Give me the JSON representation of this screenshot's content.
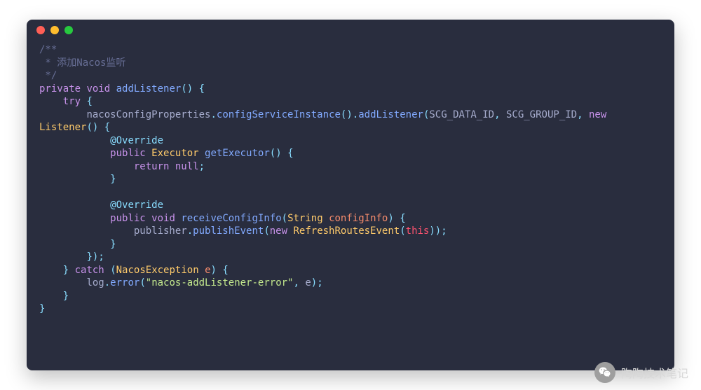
{
  "window": {
    "dots": [
      "red",
      "yellow",
      "green"
    ]
  },
  "code": {
    "comment_open": "/**",
    "comment_body": " * 添加Nacos监听",
    "comment_close": " */",
    "kw_private": "private",
    "kw_void": "void",
    "kw_try": "try",
    "kw_catch": "catch",
    "kw_new": "new",
    "kw_public": "public",
    "kw_return": "return",
    "kw_null": "null",
    "anno_override": "@Override",
    "fn_addListener": "addListener",
    "fn_configServiceInstance": "configServiceInstance",
    "fn_getExecutor": "getExecutor",
    "fn_receiveConfigInfo": "receiveConfigInfo",
    "fn_publishEvent": "publishEvent",
    "fn_error": "error",
    "type_Executor": "Executor",
    "type_String": "String",
    "type_Listener": "Listener",
    "type_NacosException": "NacosException",
    "type_RefreshRoutesEvent": "RefreshRoutesEvent",
    "id_nacosConfigProperties": "nacosConfigProperties",
    "id_SCG_DATA_ID": "SCG_DATA_ID",
    "id_SCG_GROUP_ID": "SCG_GROUP_ID",
    "id_configInfo": "configInfo",
    "id_publisher": "publisher",
    "id_log": "log",
    "id_e": "e",
    "kw_this": "this",
    "str_err": "\"nacos-addListener-error\"",
    "p_lparen": "(",
    "p_rparen": ")",
    "p_lbrace": "{",
    "p_rbrace": "}",
    "p_semi": ";",
    "p_dot": ".",
    "p_comma": ",",
    "sp": " ",
    "ind1": "    ",
    "ind2": "        ",
    "ind3": "            ",
    "ind4": "                ",
    "ind5": "                    "
  },
  "watermark": {
    "text": "陶陶技术笔记",
    "icon": "wechat-icon"
  }
}
